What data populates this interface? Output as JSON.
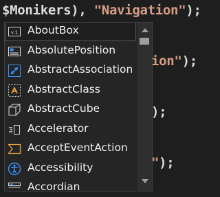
{
  "code_lines": [
    [
      {
        "t": "$Monikers), ",
        "c": "plain"
      },
      {
        "t": "\"Navigation\"",
        "c": "str"
      },
      {
        "t": ");",
        "c": "plain"
      }
    ],
    [
      {
        "t": "ion\"",
        "c": "str"
      },
      {
        "t": ");",
        "c": "plain"
      }
    ],
    [
      {
        "t": ");",
        "c": "plain"
      }
    ],
    [
      {
        "t": "\"",
        "c": "str"
      },
      {
        "t": ");",
        "c": "plain"
      }
    ]
  ],
  "completion": {
    "items": [
      {
        "label": "AboutBox",
        "icon": "about-box-icon",
        "selected": true
      },
      {
        "label": "AbsolutePosition",
        "icon": "absolute-position-icon"
      },
      {
        "label": "AbstractAssociation",
        "icon": "abstract-association-icon"
      },
      {
        "label": "AbstractClass",
        "icon": "abstract-class-icon"
      },
      {
        "label": "AbstractCube",
        "icon": "abstract-cube-icon"
      },
      {
        "label": "Accelerator",
        "icon": "accelerator-icon"
      },
      {
        "label": "AcceptEventAction",
        "icon": "accept-event-action-icon"
      },
      {
        "label": "Accessibility",
        "icon": "accessibility-icon"
      },
      {
        "label": "Accordian",
        "icon": "accordian-icon"
      }
    ],
    "about_icon_text": "v.1"
  },
  "colors": {
    "editor_bg": "#1e1e1e",
    "string": "#d69d85",
    "text": "#dcdcdc",
    "accent": "#3794ff"
  }
}
